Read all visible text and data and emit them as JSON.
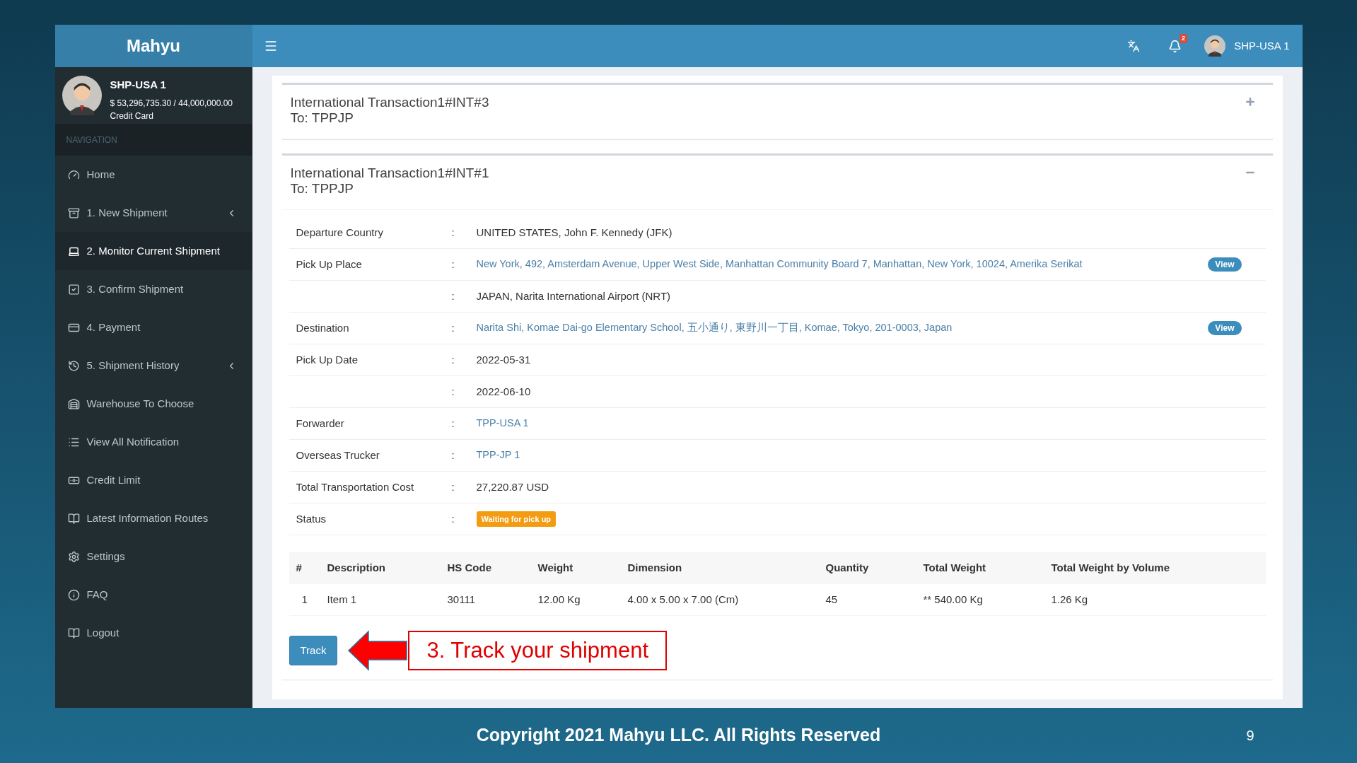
{
  "app": {
    "logo": "Mahyu",
    "user_name": "SHP-USA 1",
    "notification_count": "2"
  },
  "user_panel": {
    "name": "SHP-USA 1",
    "balance": "$ 53,296,735.30 / 44,000,000.00",
    "payment": "Credit Card"
  },
  "sidebar": {
    "header": "NAVIGATION",
    "items": [
      {
        "label": "Home",
        "selected": false,
        "has_submenu": false
      },
      {
        "label": "1. New Shipment",
        "selected": false,
        "has_submenu": true
      },
      {
        "label": "2. Monitor Current Shipment",
        "selected": true,
        "has_submenu": false
      },
      {
        "label": "3. Confirm Shipment",
        "selected": false,
        "has_submenu": false
      },
      {
        "label": "4. Payment",
        "selected": false,
        "has_submenu": false
      },
      {
        "label": "5. Shipment History",
        "selected": false,
        "has_submenu": true
      },
      {
        "label": "Warehouse To Choose",
        "selected": false,
        "has_submenu": false
      },
      {
        "label": "View All Notification",
        "selected": false,
        "has_submenu": false
      },
      {
        "label": "Credit Limit",
        "selected": false,
        "has_submenu": false
      },
      {
        "label": "Latest Information Routes",
        "selected": false,
        "has_submenu": false
      },
      {
        "label": "Settings",
        "selected": false,
        "has_submenu": false
      },
      {
        "label": "FAQ",
        "selected": false,
        "has_submenu": false
      },
      {
        "label": "Logout",
        "selected": false,
        "has_submenu": false
      }
    ]
  },
  "transactions": [
    {
      "title": "International Transaction1#INT#3",
      "to": "To: TPPJP",
      "expanded": false
    },
    {
      "title": "International Transaction1#INT#1",
      "to": "To: TPPJP",
      "expanded": true,
      "details": [
        {
          "label": "Departure Country",
          "separator": ":",
          "value": "UNITED STATES, John F. Kennedy (JFK)",
          "kind": "text"
        },
        {
          "label": "Pick Up Place",
          "separator": ":",
          "value": "New York, 492, Amsterdam Avenue, Upper West Side, Manhattan Community Board 7, Manhattan, New York, 10024, Amerika Serikat",
          "kind": "link",
          "button": "View"
        },
        {
          "separator": ":",
          "value": "JAPAN, Narita International Airport (NRT)",
          "kind": "text"
        },
        {
          "label": "Destination",
          "separator": ":",
          "value": "Narita Shi, Komae Dai-go Elementary School, 五小通り, 東野川一丁目, Komae, Tokyo, 201-0003, Japan",
          "kind": "link",
          "button": "View"
        },
        {
          "label": "Pick Up Date",
          "separator": ":",
          "value": "2022-05-31",
          "kind": "text"
        },
        {
          "separator": ":",
          "value": "2022-06-10",
          "kind": "text"
        },
        {
          "label": "Forwarder",
          "separator": ":",
          "value": "TPP-USA 1",
          "kind": "link"
        },
        {
          "label": "Overseas Trucker",
          "separator": ":",
          "value": "TPP-JP 1",
          "kind": "link"
        },
        {
          "label": "Total Transportation Cost",
          "separator": ":",
          "value": "27,220.87 USD",
          "kind": "text"
        },
        {
          "label": "Status",
          "separator": ":",
          "value": "Waiting for pick up",
          "kind": "badge",
          "color": "#f39c12"
        }
      ],
      "table": {
        "columns": [
          "#",
          "Description",
          "HS Code",
          "Weight",
          "Dimension",
          "Quantity",
          "Total Weight",
          "Total Weight by Volume"
        ],
        "rows": [
          [
            "1",
            "Item 1",
            "30111",
            "12.00 Kg",
            "4.00 x 5.00 x 7.00 (Cm)",
            "45",
            "** 540.00 Kg",
            "1.26 Kg"
          ]
        ]
      },
      "track_button": "Track"
    }
  ],
  "annotation": "3. Track your shipment",
  "slide": {
    "footer": "Copyright 2021 Mahyu LLC. All Rights Reserved",
    "page_number": "9"
  }
}
